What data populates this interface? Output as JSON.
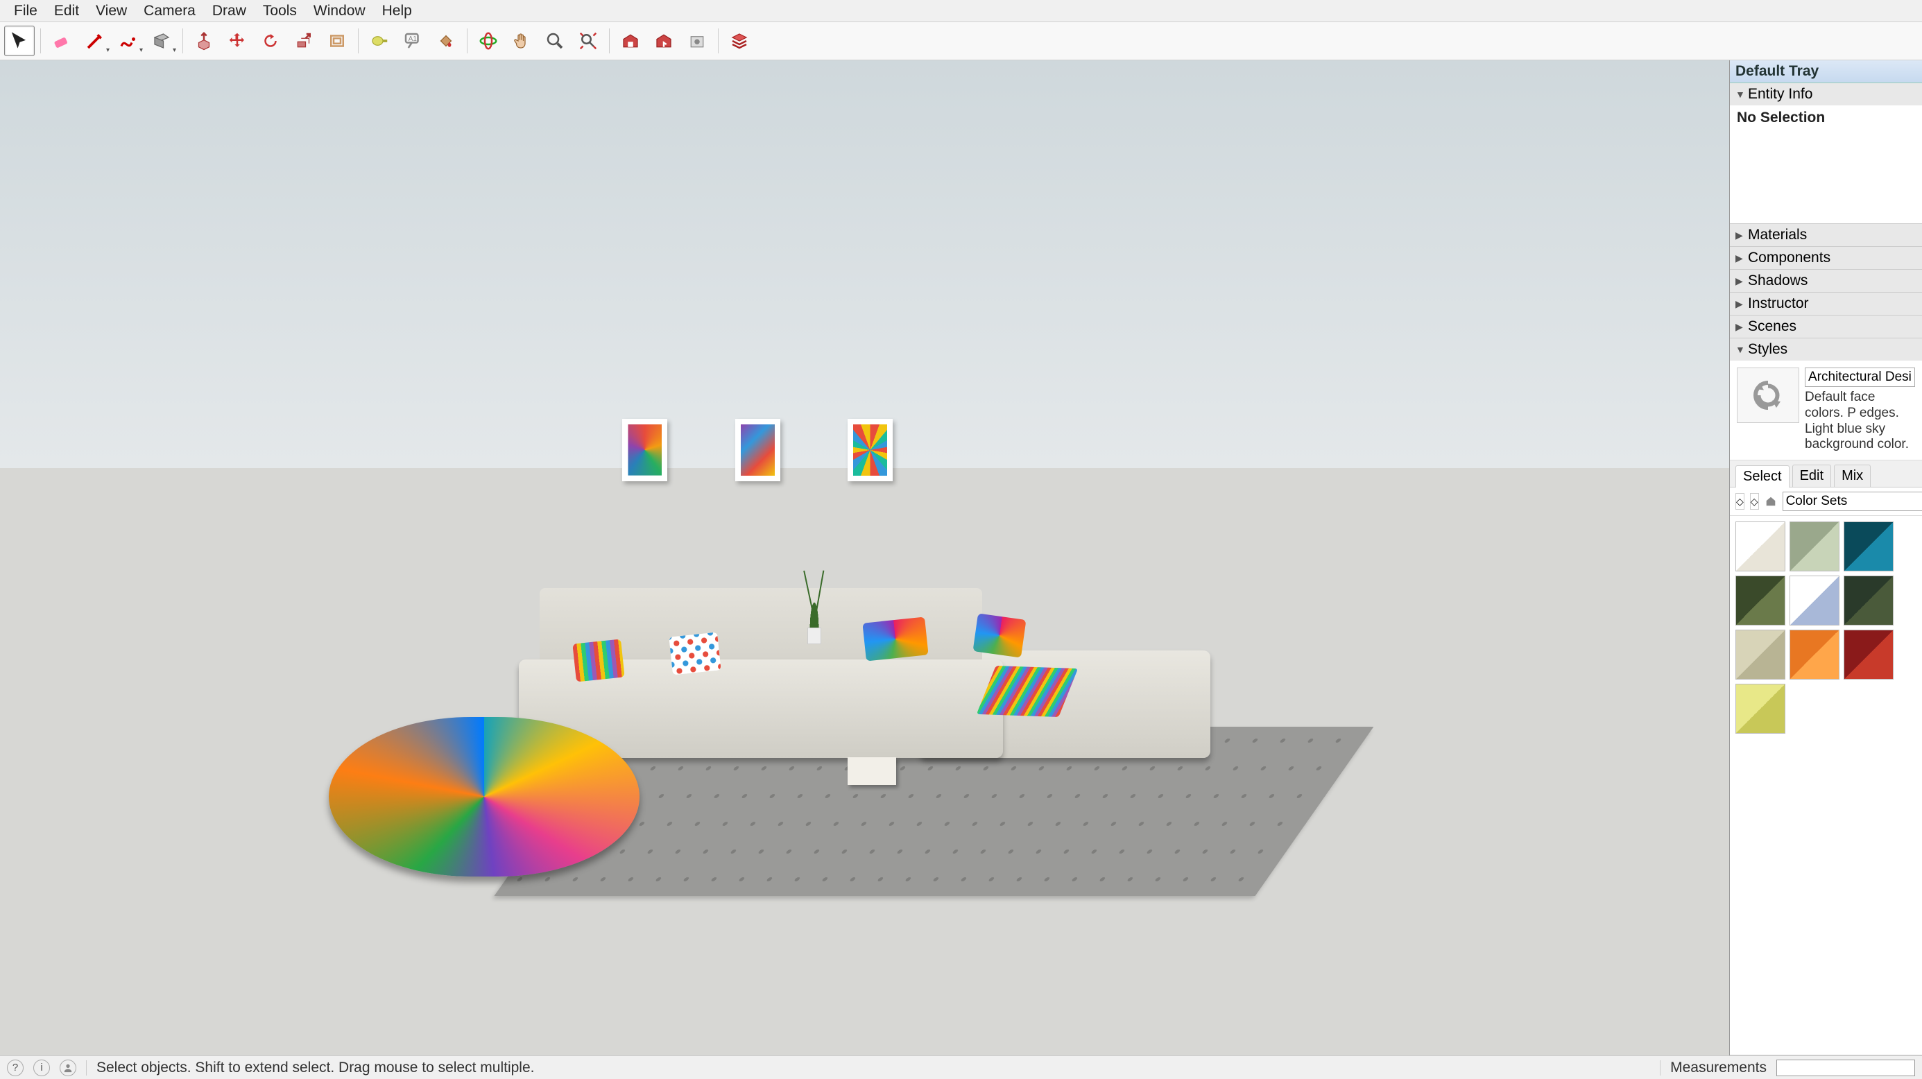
{
  "menu": [
    "File",
    "Edit",
    "View",
    "Camera",
    "Draw",
    "Tools",
    "Window",
    "Help"
  ],
  "toolbar": {
    "select": "Select",
    "eraser": "Eraser",
    "line": "Line",
    "freehand": "Freehand",
    "rectangle": "Rectangle",
    "pushpull": "Push/Pull",
    "move": "Move",
    "rotate": "Rotate",
    "scale": "Scale",
    "offset": "Offset",
    "tape": "Tape Measure",
    "text": "Text",
    "dim": "Dimensions",
    "paint": "Paint Bucket",
    "orbit": "Orbit",
    "pan": "Pan",
    "zoom": "Zoom",
    "zoomext": "Zoom Extents",
    "warehouse": "3D Warehouse",
    "share": "Share Model",
    "ext": "Extension Warehouse",
    "layers": "Layers"
  },
  "tray": {
    "title": "Default Tray",
    "entity": {
      "label": "Entity Info",
      "status": "No Selection"
    },
    "sections": [
      "Materials",
      "Components",
      "Shadows",
      "Instructor",
      "Scenes"
    ],
    "styles": {
      "label": "Styles",
      "name": "Architectural Design S",
      "desc": "Default face colors. P edges. Light blue sky background color.",
      "tabs": [
        "Select",
        "Edit",
        "Mix"
      ],
      "collection": "Color Sets"
    }
  },
  "status": {
    "hint": "Select objects. Shift to extend select. Drag mouse to select multiple.",
    "measurements": "Measurements"
  }
}
